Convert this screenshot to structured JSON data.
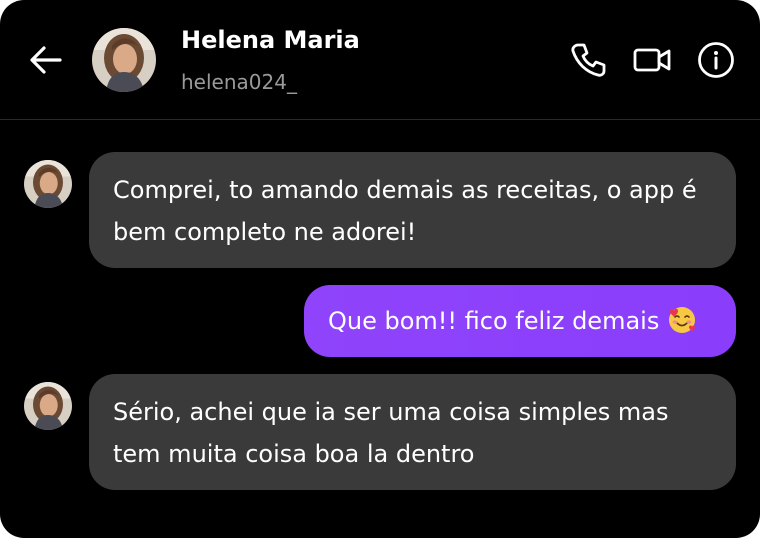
{
  "header": {
    "contact_name": "Helena Maria",
    "username": "helena024_",
    "icons": {
      "back": "arrow-left-icon",
      "call": "phone-icon",
      "video": "video-camera-icon",
      "info": "info-icon"
    }
  },
  "messages": [
    {
      "direction": "incoming",
      "text": "Comprei, to amando demais as receitas, o app é bem completo ne adorei!"
    },
    {
      "direction": "outgoing",
      "text": "Que bom!! fico feliz demais",
      "emoji": "smiling-face-with-hearts"
    },
    {
      "direction": "incoming",
      "text": "Sério, achei que ia ser uma coisa simples mas tem muita coisa boa la dentro"
    }
  ],
  "colors": {
    "background": "#000000",
    "incoming_bubble": "#3a3a3b",
    "outgoing_bubble": "#8a3ffc",
    "text": "#ffffff",
    "secondary_text": "#9a9a9a"
  }
}
